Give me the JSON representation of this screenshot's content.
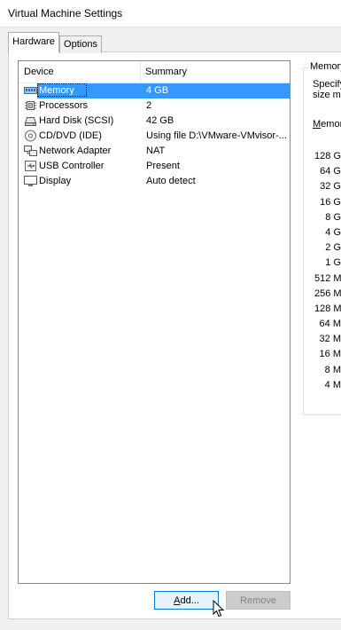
{
  "window": {
    "title": "Virtual Machine Settings"
  },
  "tabs": [
    {
      "label": "Hardware",
      "active": true
    },
    {
      "label": "Options",
      "active": false
    }
  ],
  "device_list": {
    "columns": [
      "Device",
      "Summary"
    ],
    "rows": [
      {
        "icon": "memory-icon",
        "device": "Memory",
        "summary": "4 GB",
        "selected": true
      },
      {
        "icon": "processor-icon",
        "device": "Processors",
        "summary": "2",
        "selected": false
      },
      {
        "icon": "hard-disk-icon",
        "device": "Hard Disk (SCSI)",
        "summary": "42 GB",
        "selected": false
      },
      {
        "icon": "cd-dvd-icon",
        "device": "CD/DVD (IDE)",
        "summary": "Using file D:\\VMware-VMvisor-...",
        "selected": false
      },
      {
        "icon": "network-adapter-icon",
        "device": "Network Adapter",
        "summary": "NAT",
        "selected": false
      },
      {
        "icon": "usb-controller-icon",
        "device": "USB Controller",
        "summary": "Present",
        "selected": false
      },
      {
        "icon": "display-icon",
        "device": "Display",
        "summary": "Auto detect",
        "selected": false
      }
    ]
  },
  "buttons": {
    "add_label": "Add...",
    "remove_label": "Remove",
    "remove_enabled": false
  },
  "memory_group": {
    "title": "Memory",
    "description_line1": "Specify",
    "description_line2": "size mu",
    "memory_label": "Memor",
    "scale": [
      "128 G",
      "64 G",
      "32 G",
      "16 G",
      "8 G",
      "4 G",
      "2 G",
      "1 G",
      "512 M",
      "256 M",
      "128 M",
      "64 M",
      "32 M",
      "16 M",
      "8 M",
      "4 M"
    ]
  },
  "colors": {
    "selection": "#3399ff",
    "button_focus_border": "#0078d7"
  }
}
